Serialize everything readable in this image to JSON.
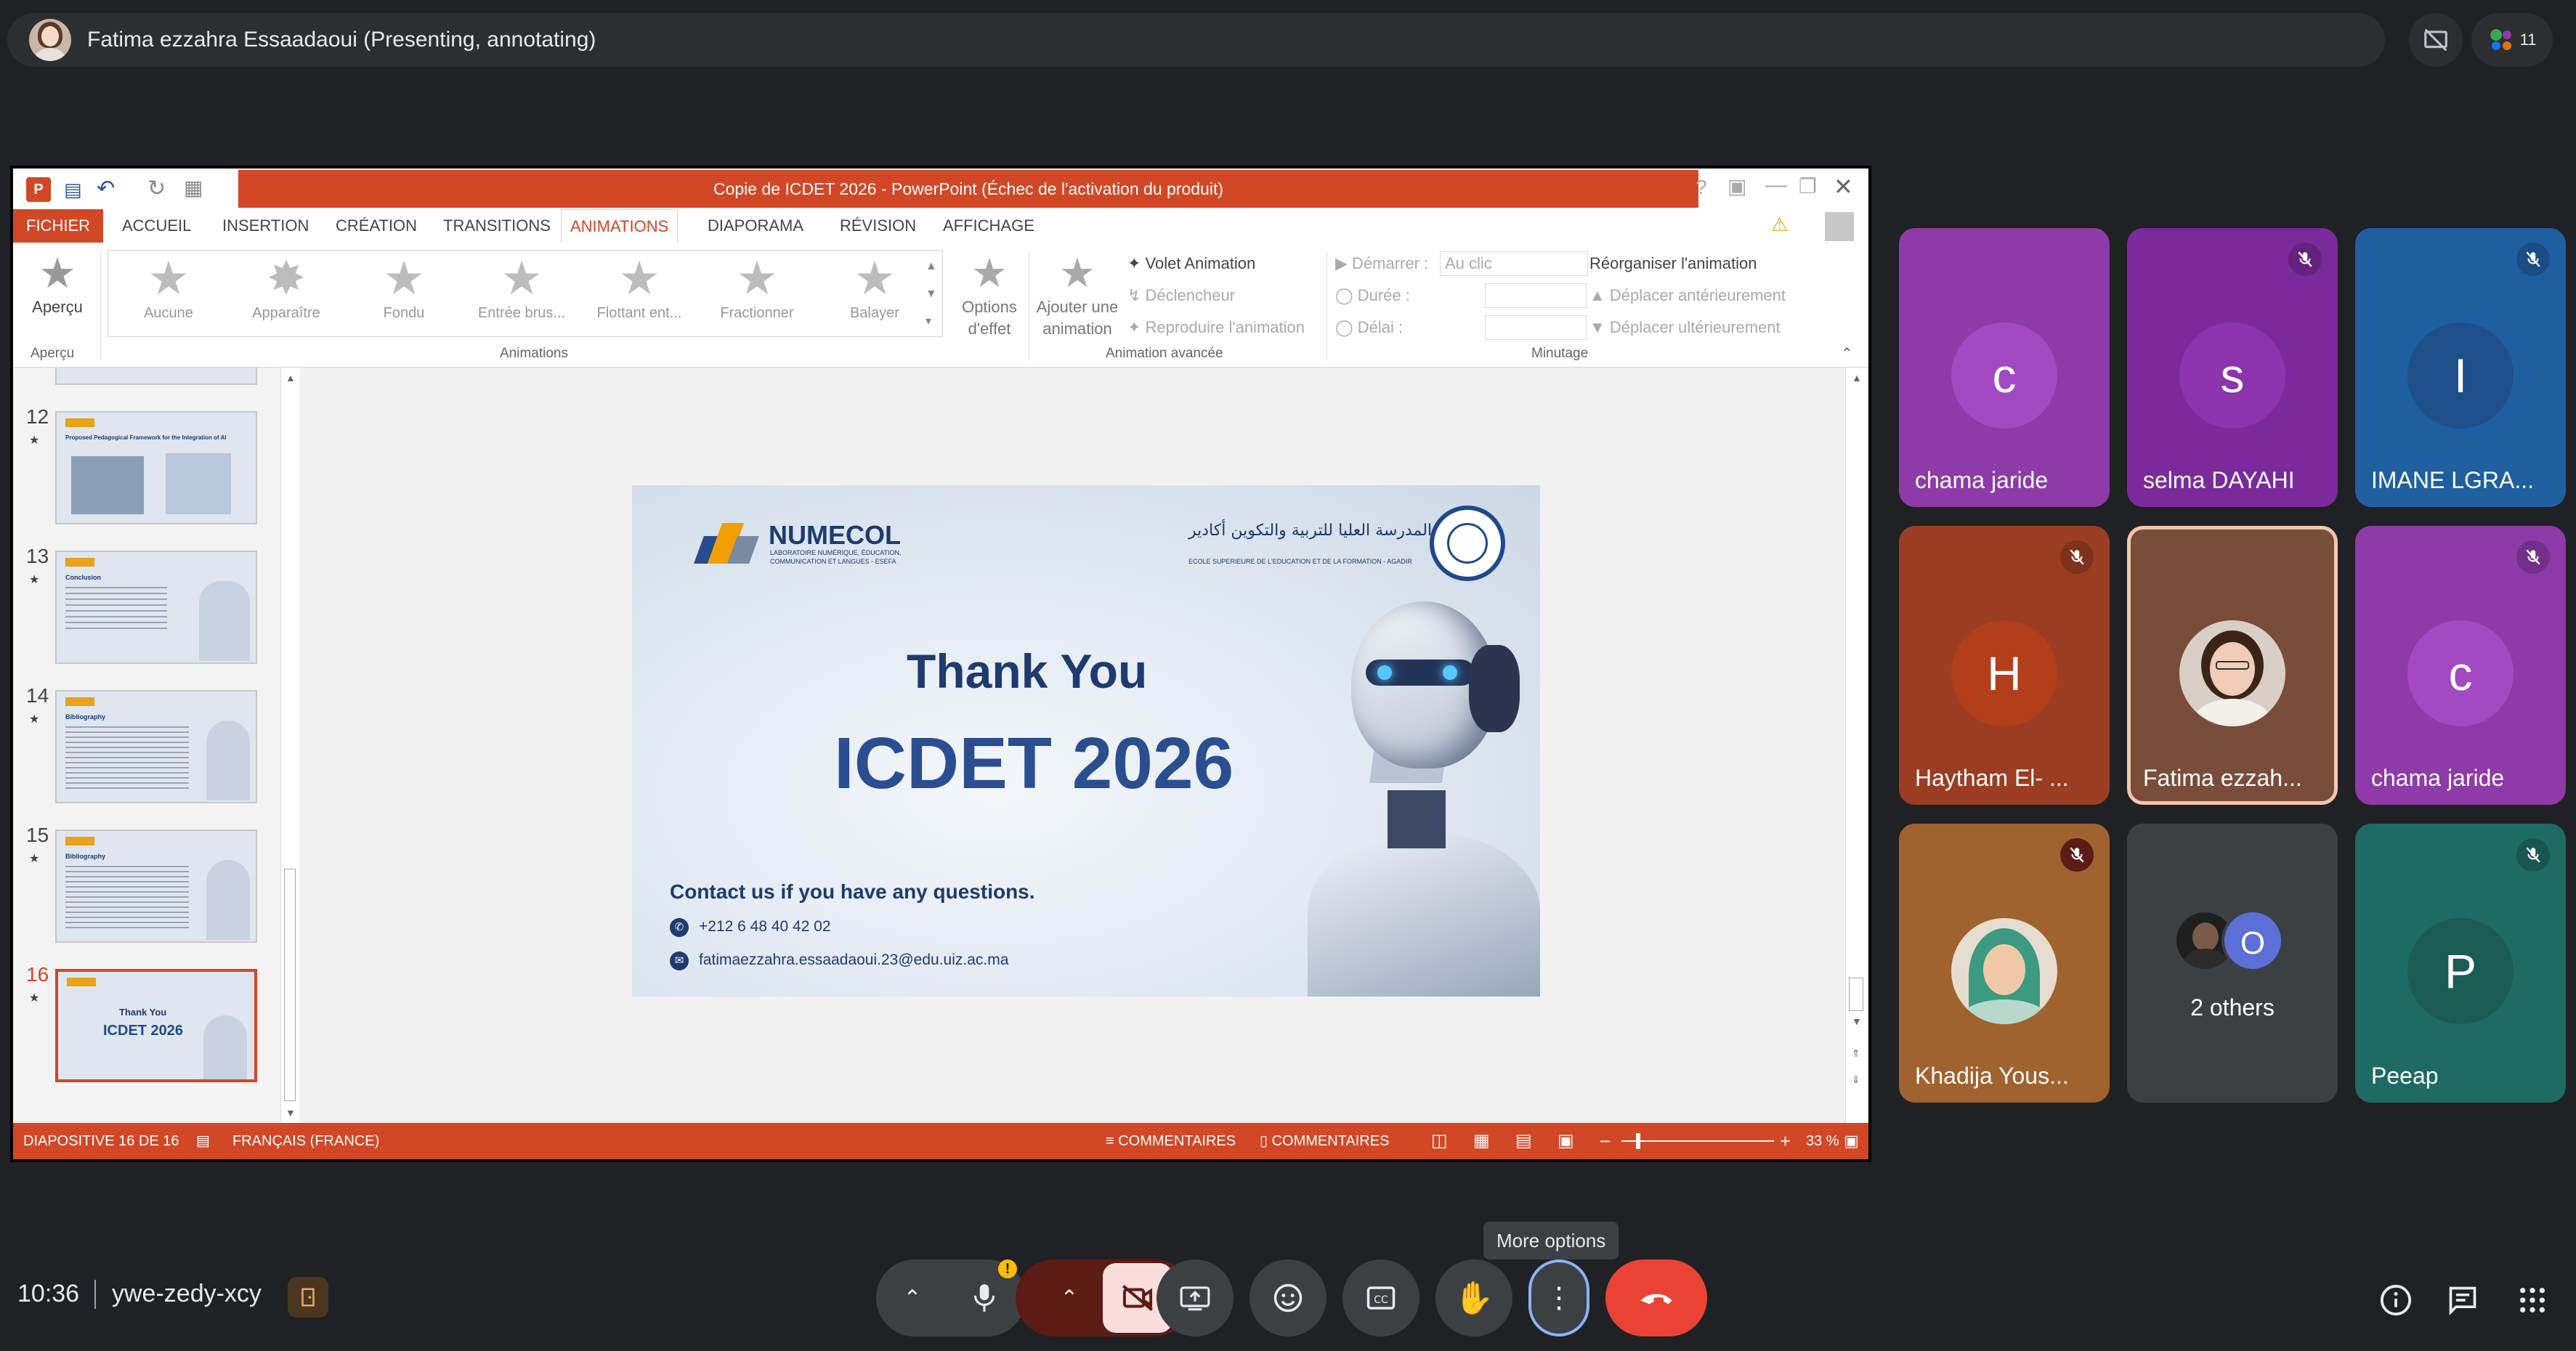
{
  "top": {
    "presenter": "Fatima ezzahra Essaadaoui (Presenting, annotating)",
    "people_count": "11"
  },
  "ppt": {
    "window_title": "Copie de ICDET 2026 - PowerPoint (Échec de l'activation du produit)",
    "tabs": [
      "FICHIER",
      "ACCUEIL",
      "INSERTION",
      "CRÉATION",
      "TRANSITIONS",
      "ANIMATIONS",
      "DIAPORAMA",
      "RÉVISION",
      "AFFICHAGE"
    ],
    "ribbon": {
      "apercu": "Aperçu",
      "apercu_group": "Aperçu",
      "animations": [
        "Aucune",
        "Apparaître",
        "Fondu",
        "Entrée brus...",
        "Flottant ent...",
        "Fractionner",
        "Balayer"
      ],
      "options_line1": "Options",
      "options_line2": "d'effet",
      "add_line1": "Ajouter une",
      "add_line2": "animation",
      "animations_group": "Animations",
      "volet": "Volet Animation",
      "declencheur": "Déclencheur",
      "reproduire": "Reproduire l'animation",
      "advanced_group": "Animation avancée",
      "demarrer_label": "Démarrer :",
      "demarrer_value": "Au clic",
      "duree_label": "Durée :",
      "delai_label": "Délai :",
      "reorganiser": "Réorganiser l'animation",
      "deplacer_ant": "Déplacer antérieurement",
      "deplacer_ult": "Déplacer ultérieurement",
      "minutage_group": "Minutage"
    },
    "thumbnails": [
      {
        "num": "12",
        "title": "Proposed Pedagogical Framework for the Integration of AI"
      },
      {
        "num": "13",
        "title": "Conclusion"
      },
      {
        "num": "14",
        "title": "Bibliography"
      },
      {
        "num": "15",
        "title": "Bibliography"
      },
      {
        "num": "16",
        "title": "Thank You",
        "subtitle": "ICDET 2026"
      }
    ],
    "slide": {
      "logo_name": "NUMECOL",
      "logo_sub1": "LABORATOIRE NUMÉRIQUE, ÉDUCATION,",
      "logo_sub2": "COMMUNICATION ET LANGUES - ESEFA",
      "school_arabic": "المدرسة العليا للتربية والتكوين أكادير",
      "school_fr": "ECOLE SUPERIEURE DE L'EDUCATION ET DE LA FORMATION - AGADIR",
      "heading": "Thank You",
      "title": "ICDET 2026",
      "contact": "Contact us if you have any questions.",
      "phone": "+212 6 48 40 42 02",
      "email": "fatimaezzahra.essaadaoui.23@edu.uiz.ac.ma"
    },
    "status": {
      "slide_info": "DIAPOSITIVE 16 DE 16",
      "language": "FRANÇAIS (FRANCE)",
      "notes": "COMMENTAIRES",
      "comments": "COMMENTAIRES",
      "zoom": "33 %",
      "zoom_fraction": 0.33
    }
  },
  "participants": [
    {
      "name": "chama jaride",
      "initial": "c",
      "bg": "#8e3aa8",
      "avatar": "#a349c2",
      "muted": false
    },
    {
      "name": "selma DAYAHI",
      "initial": "s",
      "bg": "#7a2a9a",
      "avatar": "#8c33ad",
      "muted": true
    },
    {
      "name": "IMANE LGRA...",
      "initial": "I",
      "bg": "#1f5fa0",
      "avatar": "#1e4f8a",
      "muted": true
    },
    {
      "name": "Haytham El- ...",
      "initial": "H",
      "bg": "#9a3d22",
      "avatar": "#b23e1a",
      "muted": true
    },
    {
      "name": "Fatima ezzah...",
      "initial": "",
      "bg": "#7a4d3a",
      "avatar": "#ffffff",
      "muted": false,
      "photo": true
    },
    {
      "name": "chama jaride",
      "initial": "c",
      "bg": "#8e3aa8",
      "avatar": "#a349c2",
      "muted": true
    },
    {
      "name": "Khadija Yous...",
      "initial": "",
      "bg": "#a0622e",
      "avatar": "#ffffff",
      "muted": true,
      "photo": true
    },
    {
      "name": "2 others",
      "initial": "O",
      "bg": "#3c4043",
      "avatar": "#5b6fd6",
      "muted": false
    },
    {
      "name": "Peeap",
      "initial": "P",
      "bg": "#1e6b63",
      "avatar": "#1a5c54",
      "muted": true
    }
  ],
  "bottom": {
    "time": "10:36",
    "meeting_code": "ywe-zedy-xcy",
    "tooltip": "More options"
  },
  "colors": {
    "ppt_accent": "#d24726",
    "end_call": "#ea4335",
    "camera_off": "#f9dedc"
  }
}
